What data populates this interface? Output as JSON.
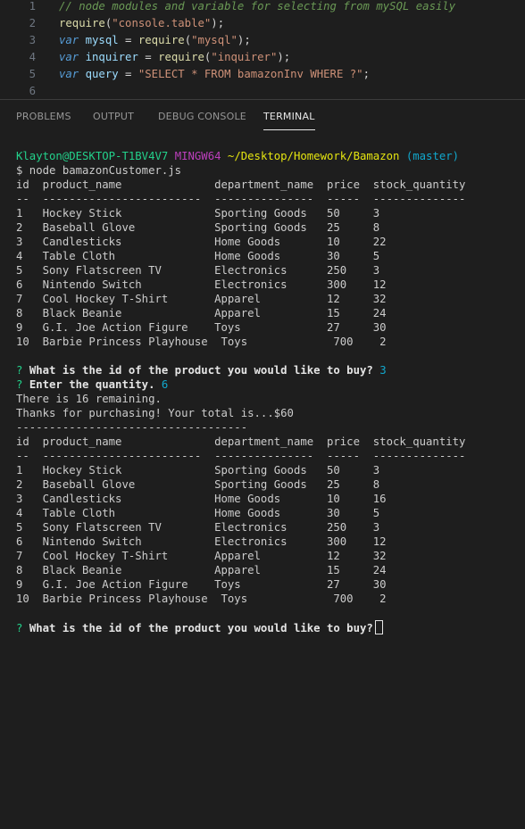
{
  "editor": {
    "lines": [
      {
        "num": "1",
        "tokens": [
          {
            "t": "// node modules and variable for selecting from mySQL easily",
            "c": "tok-comment"
          }
        ]
      },
      {
        "num": "2",
        "tokens": [
          {
            "t": "require",
            "c": "tok-fn"
          },
          {
            "t": "(",
            "c": "tok-punc"
          },
          {
            "t": "\"console.table\"",
            "c": "tok-str"
          },
          {
            "t": ");",
            "c": "tok-punc"
          }
        ]
      },
      {
        "num": "3",
        "tokens": [
          {
            "t": "var",
            "c": "tok-kw"
          },
          {
            "t": " mysql ",
            "c": "tok-var"
          },
          {
            "t": "= ",
            "c": "tok-op"
          },
          {
            "t": "require",
            "c": "tok-fn"
          },
          {
            "t": "(",
            "c": "tok-punc"
          },
          {
            "t": "\"mysql\"",
            "c": "tok-str"
          },
          {
            "t": ");",
            "c": "tok-punc"
          }
        ]
      },
      {
        "num": "4",
        "tokens": [
          {
            "t": "var",
            "c": "tok-kw"
          },
          {
            "t": " inquirer ",
            "c": "tok-var"
          },
          {
            "t": "= ",
            "c": "tok-op"
          },
          {
            "t": "require",
            "c": "tok-fn"
          },
          {
            "t": "(",
            "c": "tok-punc"
          },
          {
            "t": "\"inquirer\"",
            "c": "tok-str"
          },
          {
            "t": ");",
            "c": "tok-punc"
          }
        ]
      },
      {
        "num": "5",
        "tokens": [
          {
            "t": "var",
            "c": "tok-kw"
          },
          {
            "t": " query ",
            "c": "tok-var"
          },
          {
            "t": "= ",
            "c": "tok-op"
          },
          {
            "t": "\"SELECT * FROM bamazonInv WHERE ?\"",
            "c": "tok-str"
          },
          {
            "t": ";",
            "c": "tok-punc"
          }
        ]
      },
      {
        "num": "6",
        "tokens": []
      }
    ]
  },
  "panel": {
    "tabs": [
      {
        "label": "PROBLEMS",
        "active": false
      },
      {
        "label": "OUTPUT",
        "active": false
      },
      {
        "label": "DEBUG CONSOLE",
        "active": false
      },
      {
        "label": "TERMINAL",
        "active": true
      }
    ]
  },
  "terminal": {
    "prompt": {
      "user_host": "Klayton@DESKTOP-T1BV4V7",
      "shell": "MINGW64",
      "path": "~/Desktop/Homework/Bamazon",
      "branch": "(master)"
    },
    "command": "$ node bamazonCustomer.js",
    "table_header": "id  product_name              department_name  price  stock_quantity",
    "table_rule": "--  ------------------------  ---------------  -----  --------------",
    "table1_rows": [
      "1   Hockey Stick              Sporting Goods   50     3",
      "2   Baseball Glove            Sporting Goods   25     8",
      "3   Candlesticks              Home Goods       10     22",
      "4   Table Cloth               Home Goods       30     5",
      "5   Sony Flatscreen TV        Electronics      250    3",
      "6   Nintendo Switch           Electronics      300    12",
      "7   Cool Hockey T-Shirt       Apparel          12     32",
      "8   Black Beanie              Apparel          15     24",
      "9   G.I. Joe Action Figure    Toys             27     30",
      "10  Barbie Princess Playhouse  Toys             700    2"
    ],
    "q1_mark": "?",
    "q1_text": "What is the id of the product you would like to buy?",
    "q1_answer": "3",
    "q2_mark": "?",
    "q2_text": "Enter the quantity.",
    "q2_answer": "6",
    "msg_remaining": "There is 16 remaining.",
    "msg_thanks": "Thanks for purchasing! Your total is...$60",
    "divider": "-----------------------------------",
    "table2_rows": [
      "1   Hockey Stick              Sporting Goods   50     3",
      "2   Baseball Glove            Sporting Goods   25     8",
      "3   Candlesticks              Home Goods       10     16",
      "4   Table Cloth               Home Goods       30     5",
      "5   Sony Flatscreen TV        Electronics      250    3",
      "6   Nintendo Switch           Electronics      300    12",
      "7   Cool Hockey T-Shirt       Apparel          12     32",
      "8   Black Beanie              Apparel          15     24",
      "9   G.I. Joe Action Figure    Toys             27     30",
      "10  Barbie Princess Playhouse  Toys             700    2"
    ],
    "q3_mark": "?",
    "q3_text": "What is the id of the product you would like to buy?"
  }
}
